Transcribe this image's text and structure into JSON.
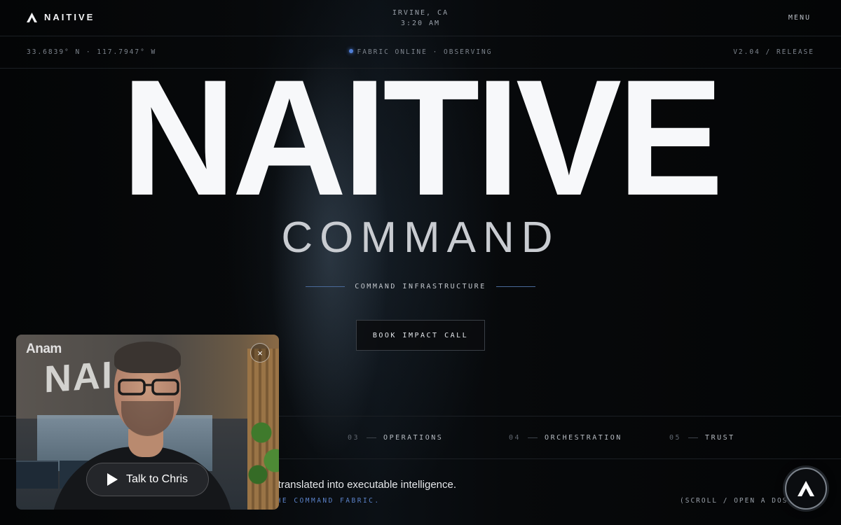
{
  "header": {
    "brand": "NAITIVE",
    "location_city": "IRVINE, CA",
    "location_time": "3:20 AM",
    "menu_label": "MENU"
  },
  "statusbar": {
    "coordinates": "33.6839° N · 117.7947° W",
    "fabric_status": "FABRIC ONLINE · OBSERVING",
    "version": "V2.04 / RELEASE"
  },
  "hero": {
    "title": "NAITIVE",
    "subtitle": "COMMAND",
    "tagline": "COMMAND INFRASTRUCTURE",
    "cta_label": "BOOK IMPACT CALL"
  },
  "sections": [
    {
      "num": "03",
      "label": "OPERATIONS"
    },
    {
      "num": "04",
      "label": "ORCHESTRATION"
    },
    {
      "num": "05",
      "label": "TRUST"
    }
  ],
  "bottom": {
    "text": "ess, translated into executable intelligence.",
    "sub": "Y THE COMMAND FABRIC.",
    "scroll_hint": "(SCROLL / OPEN A DOSS"
  },
  "video_widget": {
    "logo": "Anam",
    "close_symbol": "×",
    "talk_label": "Talk to Chris",
    "sign_text": "NAI"
  },
  "colors": {
    "background": "#050607",
    "accent_blue": "#4f7ed6",
    "text_primary": "#f7f8fa"
  }
}
